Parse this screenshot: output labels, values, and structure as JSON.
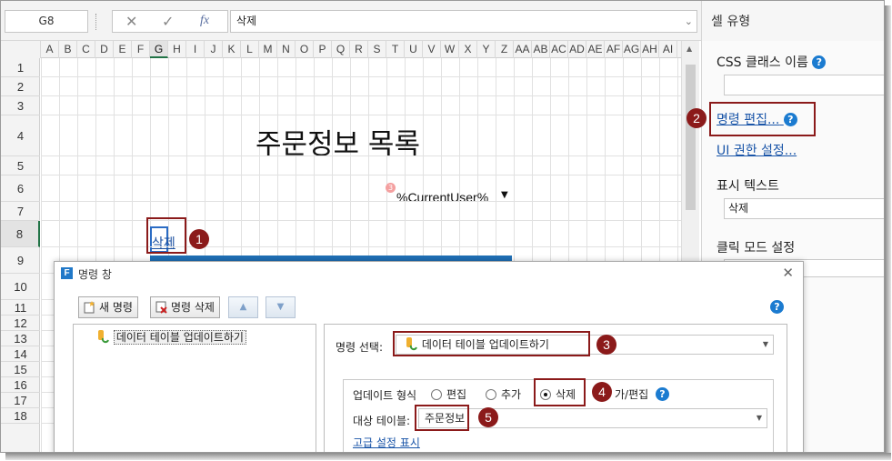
{
  "formula_bar": {
    "name_box": "G8",
    "cancel_icon": "✕",
    "enter_icon": "✓",
    "fx_icon": "fx",
    "content": "삭제"
  },
  "sheet": {
    "columns": [
      "A",
      "B",
      "C",
      "D",
      "E",
      "F",
      "G",
      "H",
      "I",
      "J",
      "K",
      "L",
      "M",
      "N",
      "O",
      "P",
      "Q",
      "R",
      "S",
      "T",
      "U",
      "V",
      "W",
      "X",
      "Y",
      "Z",
      "AA",
      "AB",
      "AC",
      "AD",
      "AE",
      "AF",
      "AG",
      "AH",
      "AI"
    ],
    "selected_column": "G",
    "rows": [
      "1",
      "2",
      "3",
      "4",
      "5",
      "6",
      "7",
      "8",
      "9",
      "10",
      "11",
      "12",
      "13",
      "14",
      "15",
      "16",
      "17",
      "18"
    ],
    "selected_row": "8",
    "title": "주문정보 목록",
    "current_user": "%CurrentUser%",
    "current_user_caret": "▼",
    "badge": "3",
    "delete_link": "삭제"
  },
  "right_panel": {
    "header": "셀 유형",
    "css_class_label": "CSS 클래스 이름",
    "css_class_value": "",
    "edit_command_link": "명령 편집...",
    "ui_permission_link": "UI 권한 설정...",
    "display_text_label": "표시 텍스트",
    "display_text_value": "삭제",
    "click_mode_label": "클릭 모드 설정",
    "help_glyph": "?"
  },
  "dialog": {
    "logo": "F",
    "title": "명령 창",
    "close": "✕",
    "new_command": "새 명령",
    "delete_command": "명령 삭제",
    "move_up": "▲",
    "move_down": "▼",
    "tree_item": "데이터 테이블 업데이트하기",
    "command_select_label": "명령 선택:",
    "command_select_value": "데이터 테이블 업데이트하기",
    "update_type_label": "업데이트 형식",
    "radio_edit": "편집",
    "radio_add": "추가",
    "radio_delete": "삭제",
    "radio_add_edit": "가/편집",
    "selected_radio": "삭제",
    "target_table_label": "대상 테이블:",
    "target_table_value": "주문정보",
    "advanced_link": "고급 설정 표시",
    "caret": "▼"
  },
  "markers": [
    "1",
    "2",
    "3",
    "4",
    "5"
  ],
  "colors": {
    "marker": "#8b1a1a",
    "link": "#1a55a8",
    "help": "#1b7bd0",
    "selection": "#217346",
    "table_header": "#1f6fb5"
  }
}
